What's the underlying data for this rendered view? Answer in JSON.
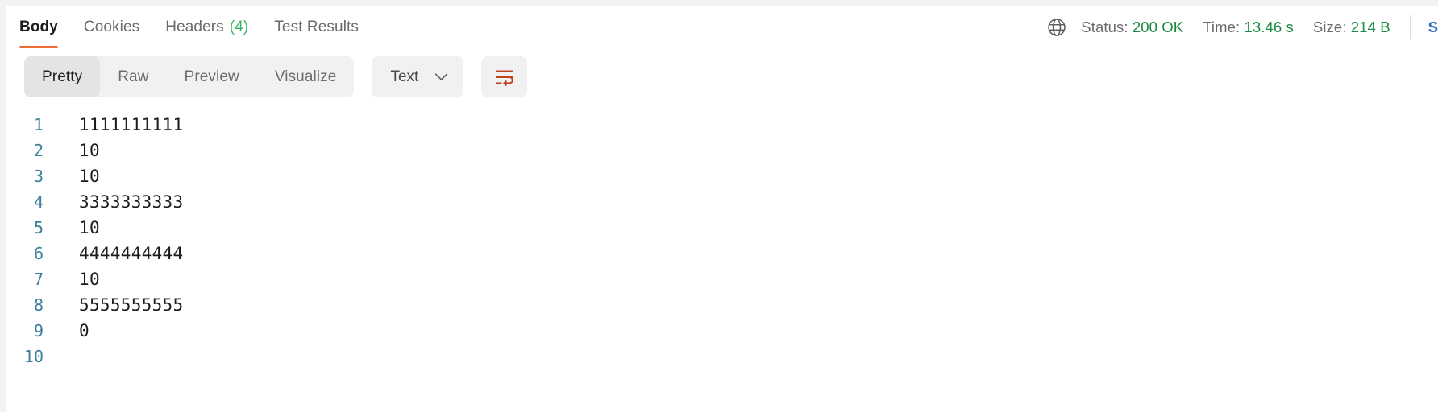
{
  "response_tabs": {
    "items": [
      {
        "label": "Body",
        "count": null,
        "active": true
      },
      {
        "label": "Cookies",
        "count": null,
        "active": false
      },
      {
        "label": "Headers",
        "count": "(4)",
        "active": false
      },
      {
        "label": "Test Results",
        "count": null,
        "active": false
      }
    ]
  },
  "meta": {
    "globe_icon": "globe-icon",
    "status_label": "Status:",
    "status_value": "200 OK",
    "time_label": "Time:",
    "time_value": "13.46 s",
    "size_label": "Size:",
    "size_value": "214 B",
    "save_label": "S",
    "value_color": "#1a8a42",
    "label_color": "#6b6b6b",
    "link_color": "#2f6fd0"
  },
  "toolbar": {
    "view_modes": [
      {
        "label": "Pretty",
        "active": true
      },
      {
        "label": "Raw",
        "active": false
      },
      {
        "label": "Preview",
        "active": false
      },
      {
        "label": "Visualize",
        "active": false
      }
    ],
    "format_dropdown": {
      "value": "Text",
      "chevron_icon": "chevron-down-icon"
    },
    "wrap_button": {
      "icon": "wrap-lines-icon",
      "color": "#c0431f"
    }
  },
  "body_viewer": {
    "lines": [
      {
        "no": "1",
        "text": "1111111111"
      },
      {
        "no": "2",
        "text": "10"
      },
      {
        "no": "3",
        "text": "10"
      },
      {
        "no": "4",
        "text": "3333333333"
      },
      {
        "no": "5",
        "text": "10"
      },
      {
        "no": "6",
        "text": "4444444444"
      },
      {
        "no": "7",
        "text": "10"
      },
      {
        "no": "8",
        "text": "5555555555"
      },
      {
        "no": "9",
        "text": "0"
      },
      {
        "no": "10",
        "text": ""
      }
    ],
    "lineno_color": "#3d7f9c"
  },
  "accent": {
    "active_tab_underline": "#ef6c37",
    "count_green": "#3cb464"
  }
}
